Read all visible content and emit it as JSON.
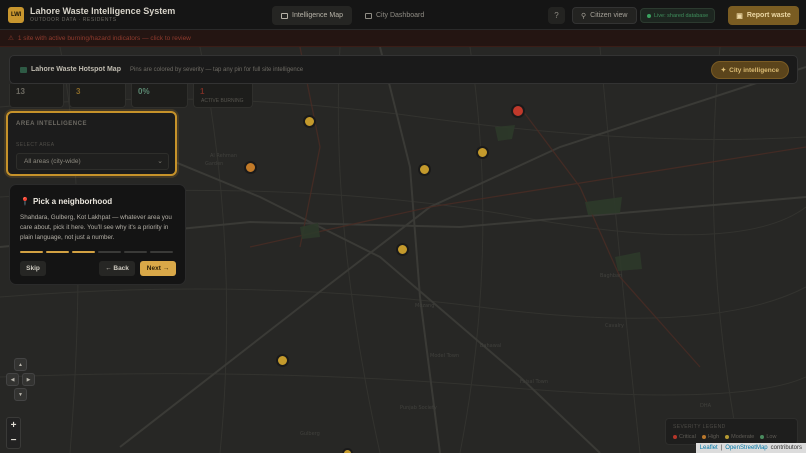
{
  "app": {
    "logo_text": "LWI",
    "title": "Lahore Waste Intelligence System",
    "subtitle": "OUTDOOR DATA · RESIDENTS"
  },
  "nav": {
    "tabs": [
      {
        "label": "Intelligence Map",
        "active": true
      },
      {
        "label": "City Dashboard",
        "active": false
      }
    ],
    "help": "?",
    "citizen_view": "Citizen view",
    "live_badge": "Live: shared database",
    "report_waste": "Report waste"
  },
  "alert": {
    "icon": "warning-icon",
    "text": "1 site with active burning/hazard indicators — click to review"
  },
  "map_header": {
    "title": "Lahore Waste Hotspot Map",
    "hint": "Pins are colored by severity — tap any pin for full site intelligence",
    "city_intel_button": "City intelligence"
  },
  "stats": [
    {
      "value": "13",
      "label": "",
      "color": "#6d6a62"
    },
    {
      "value": "3",
      "label": "",
      "color": "#8a6a28"
    },
    {
      "value": "0%",
      "label": "",
      "color": "#5c8a73"
    },
    {
      "value": "1",
      "label": "ACTIVE BURNING",
      "color": "#7a2e25"
    }
  ],
  "area_panel": {
    "title": "AREA INTELLIGENCE",
    "sub": "SELECT AREA",
    "selected": "All areas (city-wide)"
  },
  "tour": {
    "title": "Pick a neighborhood",
    "body": "Shahdara, Gulberg, Kot Lakhpat — whatever area you care about, pick it here. You'll see why it's a priority in plain language, not just a number.",
    "steps_total": 6,
    "steps_done": 3,
    "skip": "Skip",
    "back": "← Back",
    "next": "Next →"
  },
  "map_controls": {
    "pan_up": "▲",
    "pan_left": "◀",
    "pan_right": "▶",
    "pan_down": "▼",
    "zoom_in": "+",
    "zoom_out": "−"
  },
  "legend": {
    "title": "SEVERITY LEGEND",
    "items": [
      {
        "label": "Critical",
        "color": "#b5362a"
      },
      {
        "label": "High",
        "color": "#b8772c"
      },
      {
        "label": "Moderate",
        "color": "#b59a32"
      },
      {
        "label": "Low",
        "color": "#4a8a5e"
      }
    ]
  },
  "attribution": {
    "leaflet": "Leaflet",
    "separator": "|",
    "osm": "OpenStreetMap",
    "suffix": "contributors"
  },
  "pins": [
    {
      "severity": "critical",
      "color": "#c0392b"
    },
    {
      "severity": "moderate",
      "color": "#c49a2c"
    },
    {
      "severity": "moderate",
      "color": "#c49a2c"
    },
    {
      "severity": "moderate",
      "color": "#c49a2c"
    },
    {
      "severity": "high",
      "color": "#c27a28"
    },
    {
      "severity": "moderate",
      "color": "#c49a2c"
    },
    {
      "severity": "moderate",
      "color": "#c49a2c"
    },
    {
      "severity": "moderate",
      "color": "#c49a2c"
    }
  ]
}
